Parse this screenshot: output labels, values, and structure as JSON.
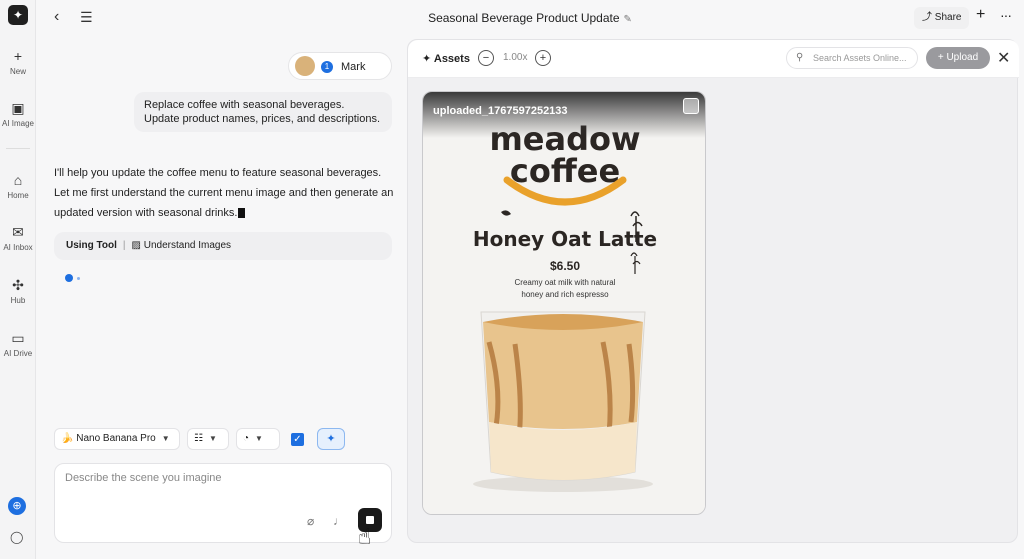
{
  "sidebar": {
    "items": [
      {
        "label": "New",
        "icon": "plus-icon"
      },
      {
        "label": "AI Image",
        "icon": "image-edit-icon"
      },
      {
        "label": "Home",
        "icon": "home-icon"
      },
      {
        "label": "AI Inbox",
        "icon": "inbox-icon"
      },
      {
        "label": "Hub",
        "icon": "hub-icon"
      },
      {
        "label": "AI Drive",
        "icon": "folder-icon"
      }
    ]
  },
  "header": {
    "title": "Seasonal Beverage Product Update",
    "share_label": "Share"
  },
  "chat": {
    "user_name": "Mark",
    "user_message": "Replace coffee with seasonal beverages. Update product names, prices, and descriptions.",
    "ai_message": "I'll help you update the coffee menu to feature seasonal beverages. Let me first understand the current menu image and then generate an updated version with seasonal drinks.",
    "tool_label": "Using Tool",
    "tool_name": "Understand Images",
    "model_name": "Nano Banana Pro",
    "input_placeholder": "Describe the scene you imagine"
  },
  "assets": {
    "title": "Assets",
    "zoom": "1.00x",
    "search_placeholder": "Search Assets Online...",
    "upload_label": "Upload",
    "file_name": "uploaded_1767597252133",
    "poster": {
      "brand_line1": "meadow",
      "brand_line2": "coffee",
      "product": "Honey Oat Latte",
      "price": "$6.50",
      "desc_line1": "Creamy oat milk with natural",
      "desc_line2": "honey and rich espresso"
    }
  },
  "colors": {
    "accent": "#1e6fe0",
    "brand_orange": "#e9a12b"
  }
}
